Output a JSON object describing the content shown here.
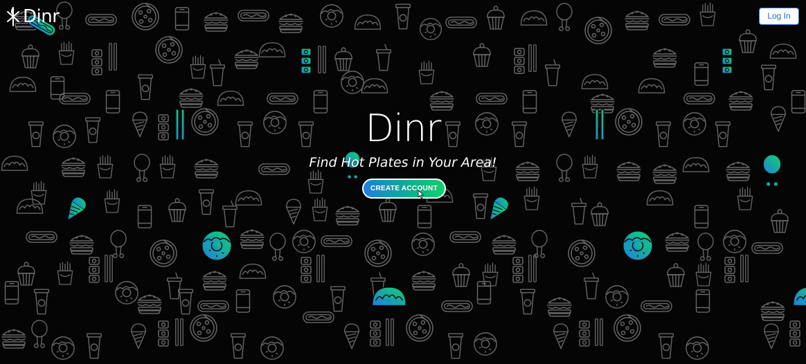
{
  "header": {
    "logo_text": "Dinr",
    "login_label": "Log In"
  },
  "hero": {
    "title": "Dinr",
    "subtitle": "Find Hot Plates in Your Area!",
    "cta_label": "CREATE ACCOUNT"
  },
  "background": {
    "icon_set": [
      "burger-icon",
      "fries-icon",
      "pizza-icon",
      "donut-icon",
      "ice-cream-icon",
      "chicken-leg-icon",
      "hotdog-icon",
      "taco-icon",
      "soda-cup-icon",
      "coffee-cup-icon",
      "cupcake-icon",
      "sushi-icon",
      "chopsticks-icon",
      "can-icon"
    ]
  },
  "colors": {
    "background": "#050505",
    "outline": "#7a7a7a",
    "accent_blue": "#1d7fe0",
    "accent_green": "#0fd06e",
    "login_text": "#1f6ad8"
  }
}
